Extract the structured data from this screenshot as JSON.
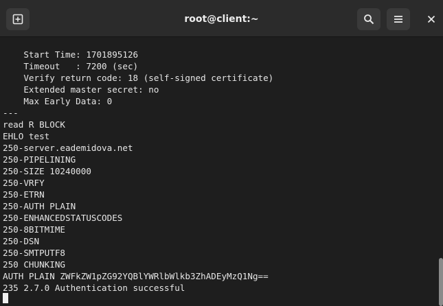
{
  "window": {
    "title": "root@client:~"
  },
  "toolbar": {
    "new_tab_icon": "new-tab-icon",
    "search_icon": "search-icon",
    "menu_icon": "hamburger-menu-icon",
    "close_icon": "close-icon"
  },
  "terminal": {
    "lines": [
      "    Start Time: 1701895126",
      "    Timeout   : 7200 (sec)",
      "    Verify return code: 18 (self-signed certificate)",
      "    Extended master secret: no",
      "    Max Early Data: 0",
      "---",
      "read R BLOCK",
      "EHLO test",
      "250-server.eademidova.net",
      "250-PIPELINING",
      "250-SIZE 10240000",
      "250-VRFY",
      "250-ETRN",
      "250-AUTH PLAIN",
      "250-ENHANCEDSTATUSCODES",
      "250-8BITMIME",
      "250-DSN",
      "250-SMTPUTF8",
      "250 CHUNKING",
      "AUTH PLAIN ZWFkZW1pZG92YQBlYWRlbWlkb3ZhADEyMzQ1Ng==",
      "235 2.7.0 Authentication successful"
    ]
  },
  "colors": {
    "background": "#1e1e1e",
    "titlebar": "#2b2b2b",
    "text": "#e6e6e6"
  }
}
